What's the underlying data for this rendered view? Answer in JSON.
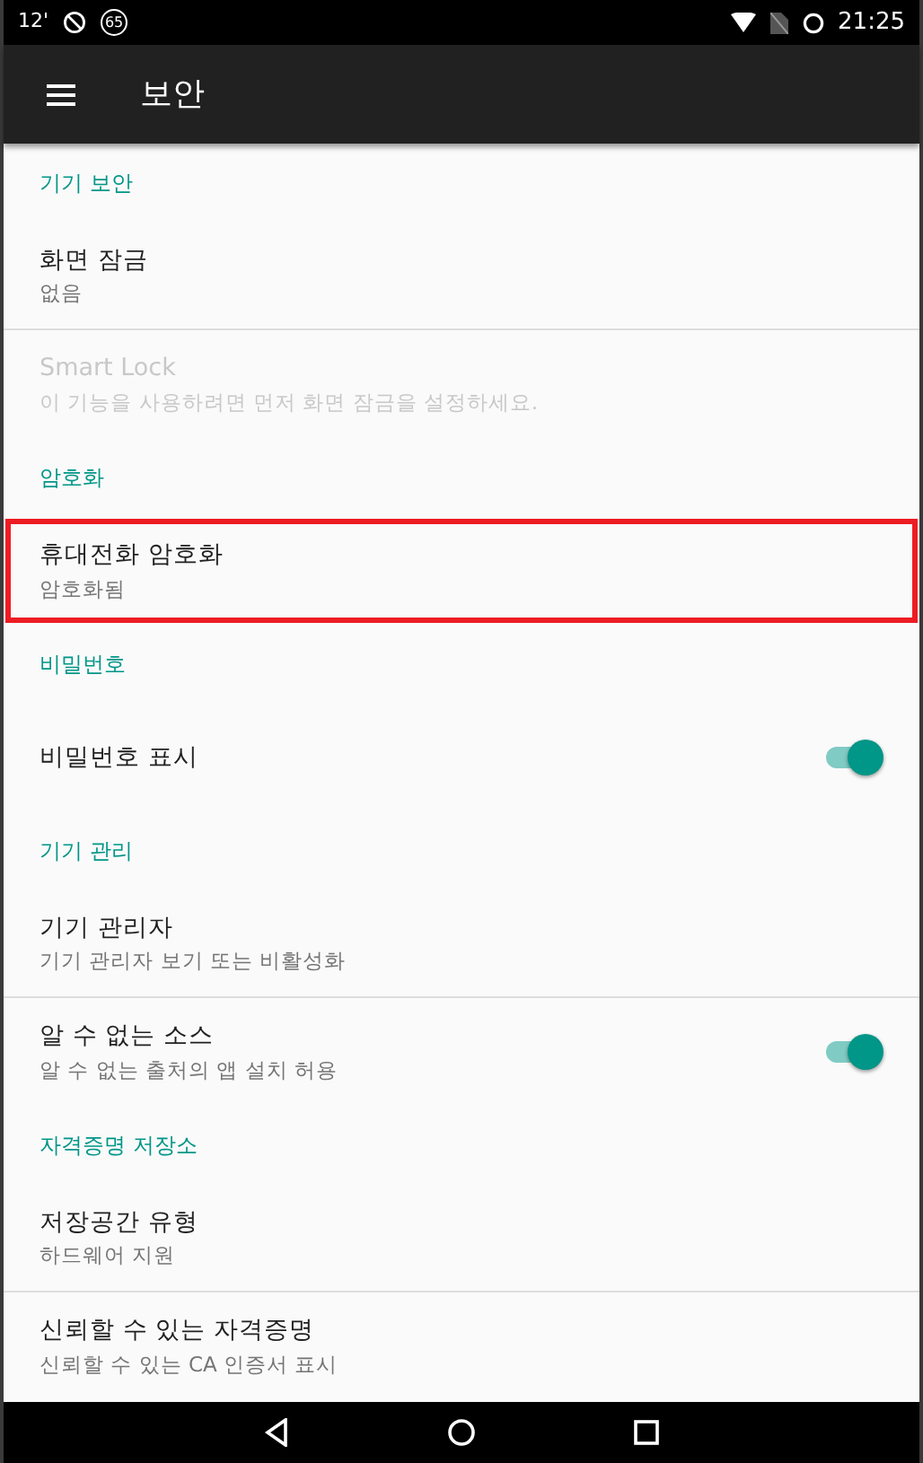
{
  "status_bar": {
    "left_text": "12'",
    "badge": "65",
    "time": "21:25"
  },
  "app_bar": {
    "title": "보안"
  },
  "items": [
    {
      "kind": "header",
      "title": "기기 보안"
    },
    {
      "kind": "item",
      "title": "화면 잠금",
      "summary": "없음",
      "disabled": false,
      "highlighted": false,
      "divider_below": true
    },
    {
      "kind": "item",
      "title": "Smart Lock",
      "summary": "이 기능을 사용하려면 먼저 화면 잠금을 설정하세요.",
      "disabled": true,
      "highlighted": false,
      "divider_below": false
    },
    {
      "kind": "header",
      "title": "암호화"
    },
    {
      "kind": "item",
      "title": "휴대전화 암호화",
      "summary": "암호화됨",
      "disabled": false,
      "highlighted": true,
      "divider_below": false
    },
    {
      "kind": "header",
      "title": "비밀번호"
    },
    {
      "kind": "toggle",
      "title": "비밀번호 표시",
      "on": true,
      "disabled": false,
      "highlighted": false,
      "divider_below": false
    },
    {
      "kind": "header",
      "title": "기기 관리"
    },
    {
      "kind": "item",
      "title": "기기 관리자",
      "summary": "기기 관리자 보기 또는 비활성화",
      "disabled": false,
      "highlighted": false,
      "divider_below": true
    },
    {
      "kind": "toggle",
      "title": "알 수 없는 소스",
      "summary": "알 수 없는 출처의 앱 설치 허용",
      "on": true,
      "disabled": false,
      "highlighted": false,
      "divider_below": false
    },
    {
      "kind": "header",
      "title": "자격증명 저장소"
    },
    {
      "kind": "item",
      "title": "저장공간 유형",
      "summary": "하드웨어 지원",
      "disabled": false,
      "highlighted": false,
      "divider_below": true
    },
    {
      "kind": "item",
      "title": "신뢰할 수 있는 자격증명",
      "summary": "신뢰할 수 있는 CA 인증서 표시",
      "disabled": false,
      "highlighted": false,
      "divider_below": false
    }
  ]
}
